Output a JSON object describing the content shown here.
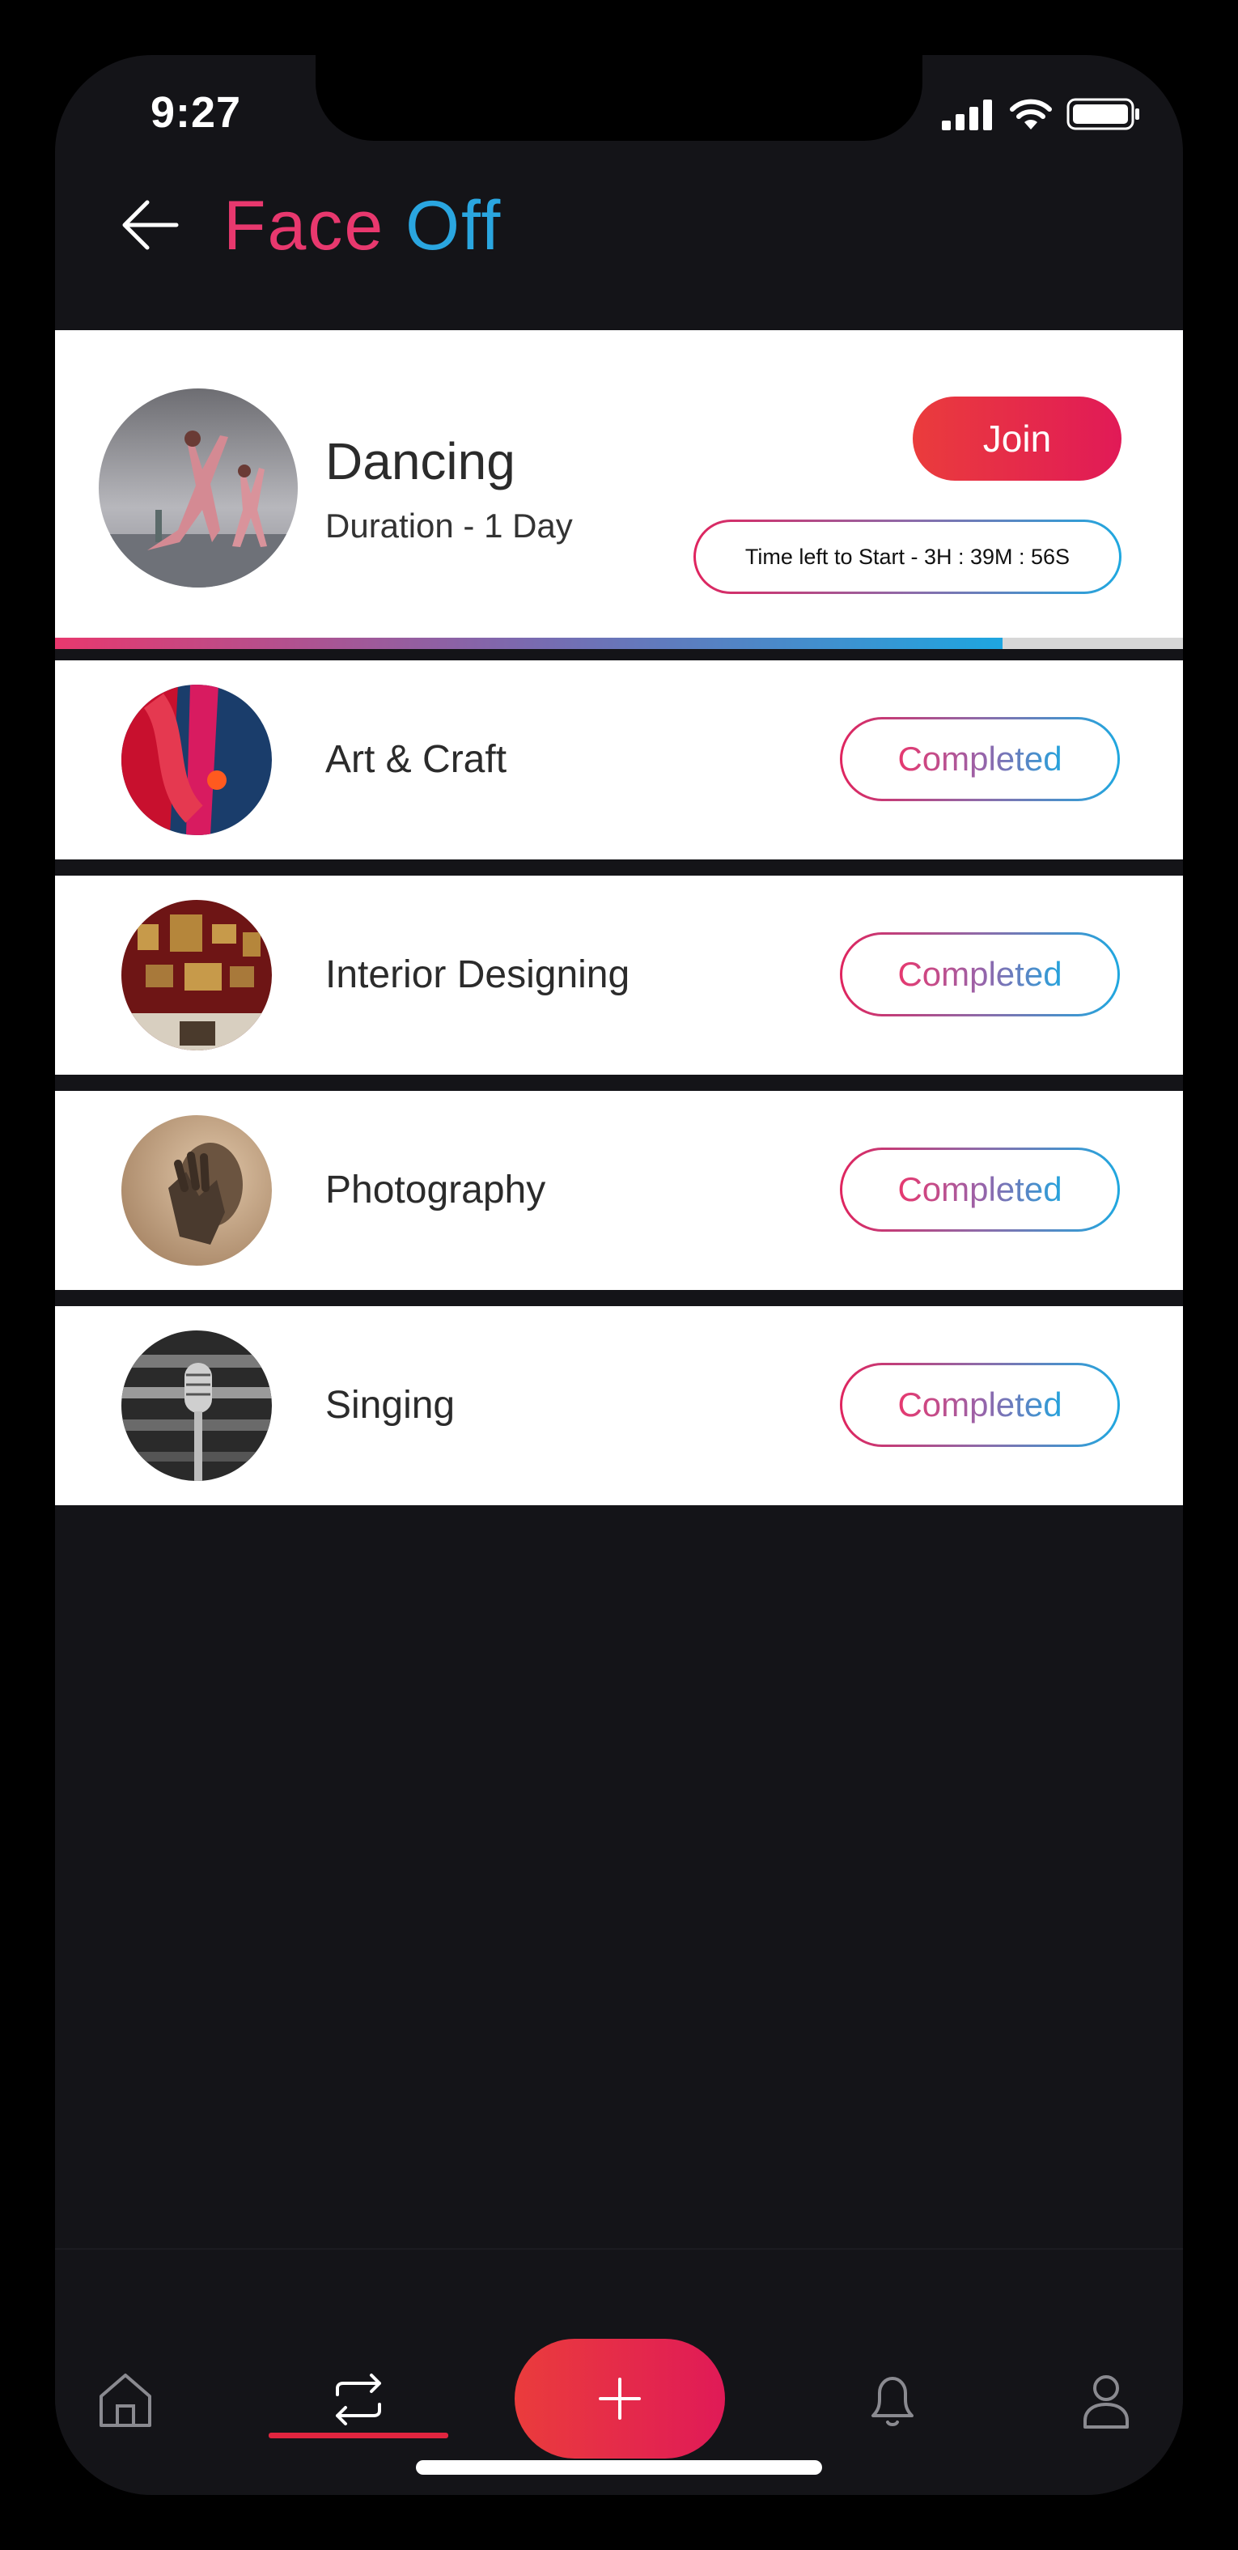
{
  "status_bar": {
    "time": "9:27"
  },
  "header": {
    "title_part1": "Face",
    "title_part2": "Off"
  },
  "featured": {
    "name": "Dancing",
    "duration": "Duration - 1 Day",
    "join_label": "Join",
    "countdown": "Time left to Start - 3H : 39M : 56S",
    "progress_fraction": 0.84
  },
  "competitions": [
    {
      "name": "Art & Craft",
      "status": "Completed"
    },
    {
      "name": "Interior Designing",
      "status": "Completed"
    },
    {
      "name": "Photography",
      "status": "Completed"
    },
    {
      "name": "Singing",
      "status": "Completed"
    }
  ],
  "tabbar": {
    "items": [
      "home-icon",
      "swap-icon",
      "plus-icon",
      "bell-icon",
      "user-icon"
    ],
    "active": "swap-icon"
  },
  "colors": {
    "pink": "#e8386e",
    "blue": "#2aa6e0",
    "accent_red": "#e1253f",
    "background": "#141418"
  }
}
